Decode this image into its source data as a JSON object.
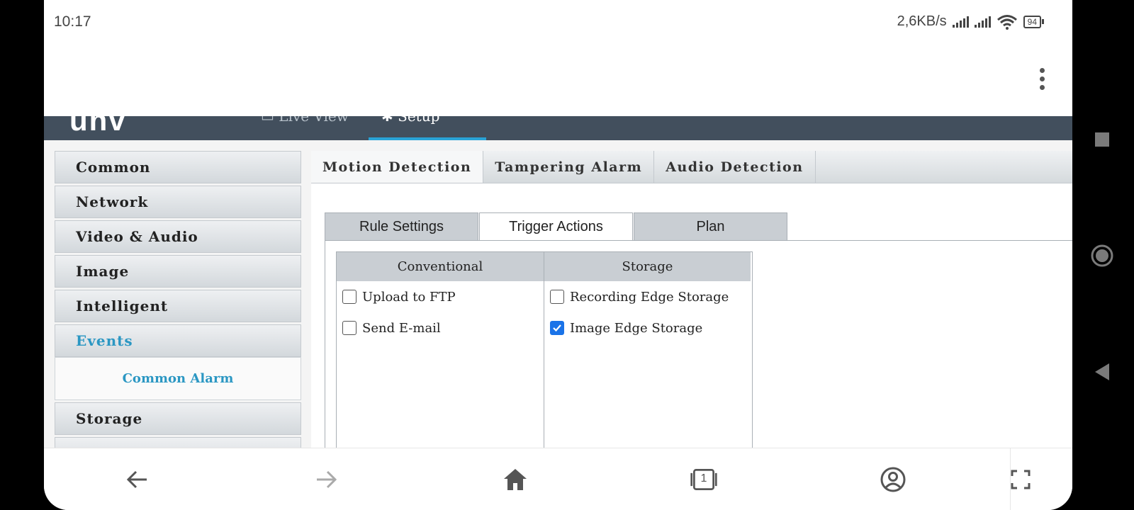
{
  "status_bar": {
    "time": "10:17",
    "network_speed": "2,6KB/s",
    "battery": "94"
  },
  "browser": {
    "menu_icon": "more-vert-icon"
  },
  "camera_ui": {
    "logo": "unv",
    "top_nav": {
      "live_view": "Live View",
      "setup": "Setup"
    },
    "sidebar": [
      {
        "label": "Common"
      },
      {
        "label": "Network"
      },
      {
        "label": "Video & Audio"
      },
      {
        "label": "Image"
      },
      {
        "label": "Intelligent"
      },
      {
        "label": "Events"
      },
      {
        "label": "Storage"
      }
    ],
    "sidebar_active": "Events",
    "sidebar_subitem": "Common Alarm",
    "event_tabs": [
      "Motion Detection",
      "Tampering Alarm",
      "Audio Detection"
    ],
    "active_event_tab": "Motion Detection",
    "sub_tabs": [
      "Rule Settings",
      "Trigger Actions",
      "Plan"
    ],
    "active_sub_tab": "Trigger Actions",
    "trigger_actions": {
      "conventional": {
        "header": "Conventional",
        "options": [
          {
            "label": "Upload to FTP",
            "checked": false
          },
          {
            "label": "Send E-mail",
            "checked": false
          }
        ]
      },
      "storage": {
        "header": "Storage",
        "options": [
          {
            "label": "Recording Edge Storage",
            "checked": false
          },
          {
            "label": "Image Edge Storage",
            "checked": true
          }
        ]
      }
    }
  },
  "browser_nav": {
    "tab_count": "1"
  },
  "colors": {
    "accent": "#2b97c3",
    "topbar": "#424f5d",
    "checkbox_checked": "#1a73e8"
  }
}
